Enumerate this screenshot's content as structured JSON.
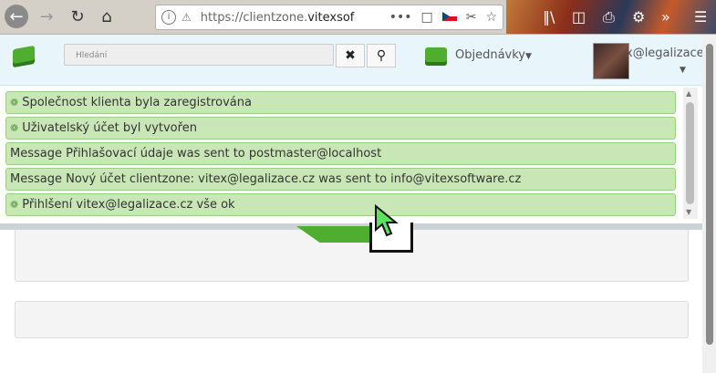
{
  "browser": {
    "url_prefix": "https://clientzone.",
    "url_host": "vitexsof",
    "url_info_icon": "info-icon",
    "url_lock_icon": "insecure-lock-icon"
  },
  "header": {
    "search_placeholder": "Hledání",
    "orders_label": "Objednávky",
    "user_label": "x@legalizace"
  },
  "messages": [
    {
      "text": "Společnost klienta byla zaregistrována",
      "icon": true
    },
    {
      "text": "Uživatelský účet byl vytvořen",
      "icon": true
    },
    {
      "text": "Message Přihlašovací údaje was sent to postmaster@localhost",
      "icon": false
    },
    {
      "text": "Message Nový účet clientzone: vitex@legalizace.cz was sent to info@vitexsoftware.cz",
      "icon": false
    },
    {
      "text": "Přihlšení vitex@legalizace.cz vše ok",
      "icon": true
    }
  ],
  "colors": {
    "message_bg": "#c9e7b6",
    "header_bg": "#e8f6fb",
    "accent_green": "#4fae2f"
  }
}
